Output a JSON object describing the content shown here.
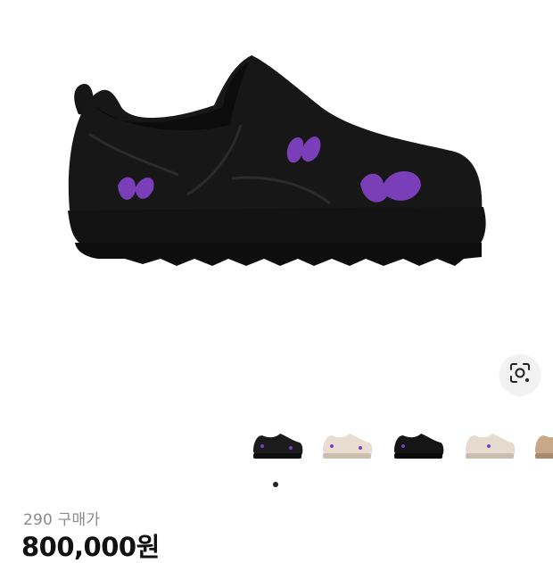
{
  "product": {
    "image_alt": "black slip-on shoe with purple butterfly embroidery",
    "size_label": "290 구매가",
    "price": "800,000원"
  },
  "gallery": {
    "thumbnails": [
      {
        "colorway": "black",
        "color": "#1b1b1b"
      },
      {
        "colorway": "cream",
        "color": "#e8ddd0"
      },
      {
        "colorway": "black",
        "color": "#151515"
      },
      {
        "colorway": "cream",
        "color": "#e5dccf"
      },
      {
        "colorway": "tan",
        "color": "#c7a98a"
      }
    ],
    "active_index": 0
  },
  "colors": {
    "shoe": "#151515",
    "butterfly": "#7a3fb8",
    "lens_bg": "#f2f2f2"
  },
  "icons": {
    "lens": "lens-search-icon"
  }
}
